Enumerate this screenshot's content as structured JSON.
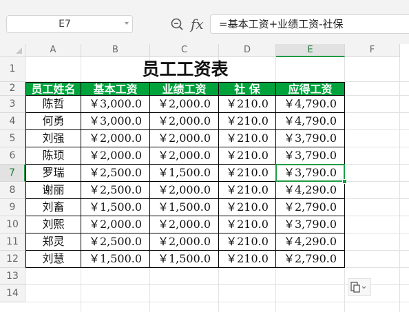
{
  "formula_bar": {
    "name_box": "E7",
    "fx_label": "fx",
    "formula": "=基本工资+业绩工资-社保"
  },
  "columns": [
    "A",
    "B",
    "C",
    "D",
    "E",
    "F"
  ],
  "rows": [
    "1",
    "2",
    "3",
    "4",
    "5",
    "6",
    "7",
    "8",
    "9",
    "10",
    "11",
    "12",
    "13",
    "14"
  ],
  "sheet": {
    "title": "员工工资表",
    "headers": [
      "员工姓名",
      "基本工资",
      "业绩工资",
      "社 保",
      "应得工资"
    ],
    "records": [
      [
        "陈哲",
        "￥3,000.0",
        "￥2,000.0",
        "￥210.0",
        "￥4,790.0"
      ],
      [
        "何勇",
        "￥3,000.0",
        "￥2,000.0",
        "￥210.0",
        "￥4,790.0"
      ],
      [
        "刘强",
        "￥2,000.0",
        "￥2,000.0",
        "￥210.0",
        "￥3,790.0"
      ],
      [
        "陈顼",
        "￥2,000.0",
        "￥2,000.0",
        "￥210.0",
        "￥3,790.0"
      ],
      [
        "罗瑞",
        "￥2,500.0",
        "￥1,500.0",
        "￥210.0",
        "￥3,790.0"
      ],
      [
        "谢丽",
        "￥2,500.0",
        "￥2,000.0",
        "￥210.0",
        "￥4,290.0"
      ],
      [
        "刘畜",
        "￥1,500.0",
        "￥1,500.0",
        "￥210.0",
        "￥2,790.0"
      ],
      [
        "刘熙",
        "￥2,000.0",
        "￥2,000.0",
        "￥210.0",
        "￥3,790.0"
      ],
      [
        "郑灵",
        "￥2,500.0",
        "￥2,000.0",
        "￥210.0",
        "￥4,290.0"
      ],
      [
        "刘慧",
        "￥1,500.0",
        "￥1,500.0",
        "￥210.0",
        "￥2,790.0"
      ]
    ]
  },
  "selection": {
    "cell": "E7",
    "column": "E",
    "row": "7"
  },
  "colors": {
    "header_fill": "#00a23c",
    "selection": "#1f9b45"
  },
  "icons": {
    "zoom": "zoom-formula-icon",
    "paste_options": "paste-options-icon"
  }
}
